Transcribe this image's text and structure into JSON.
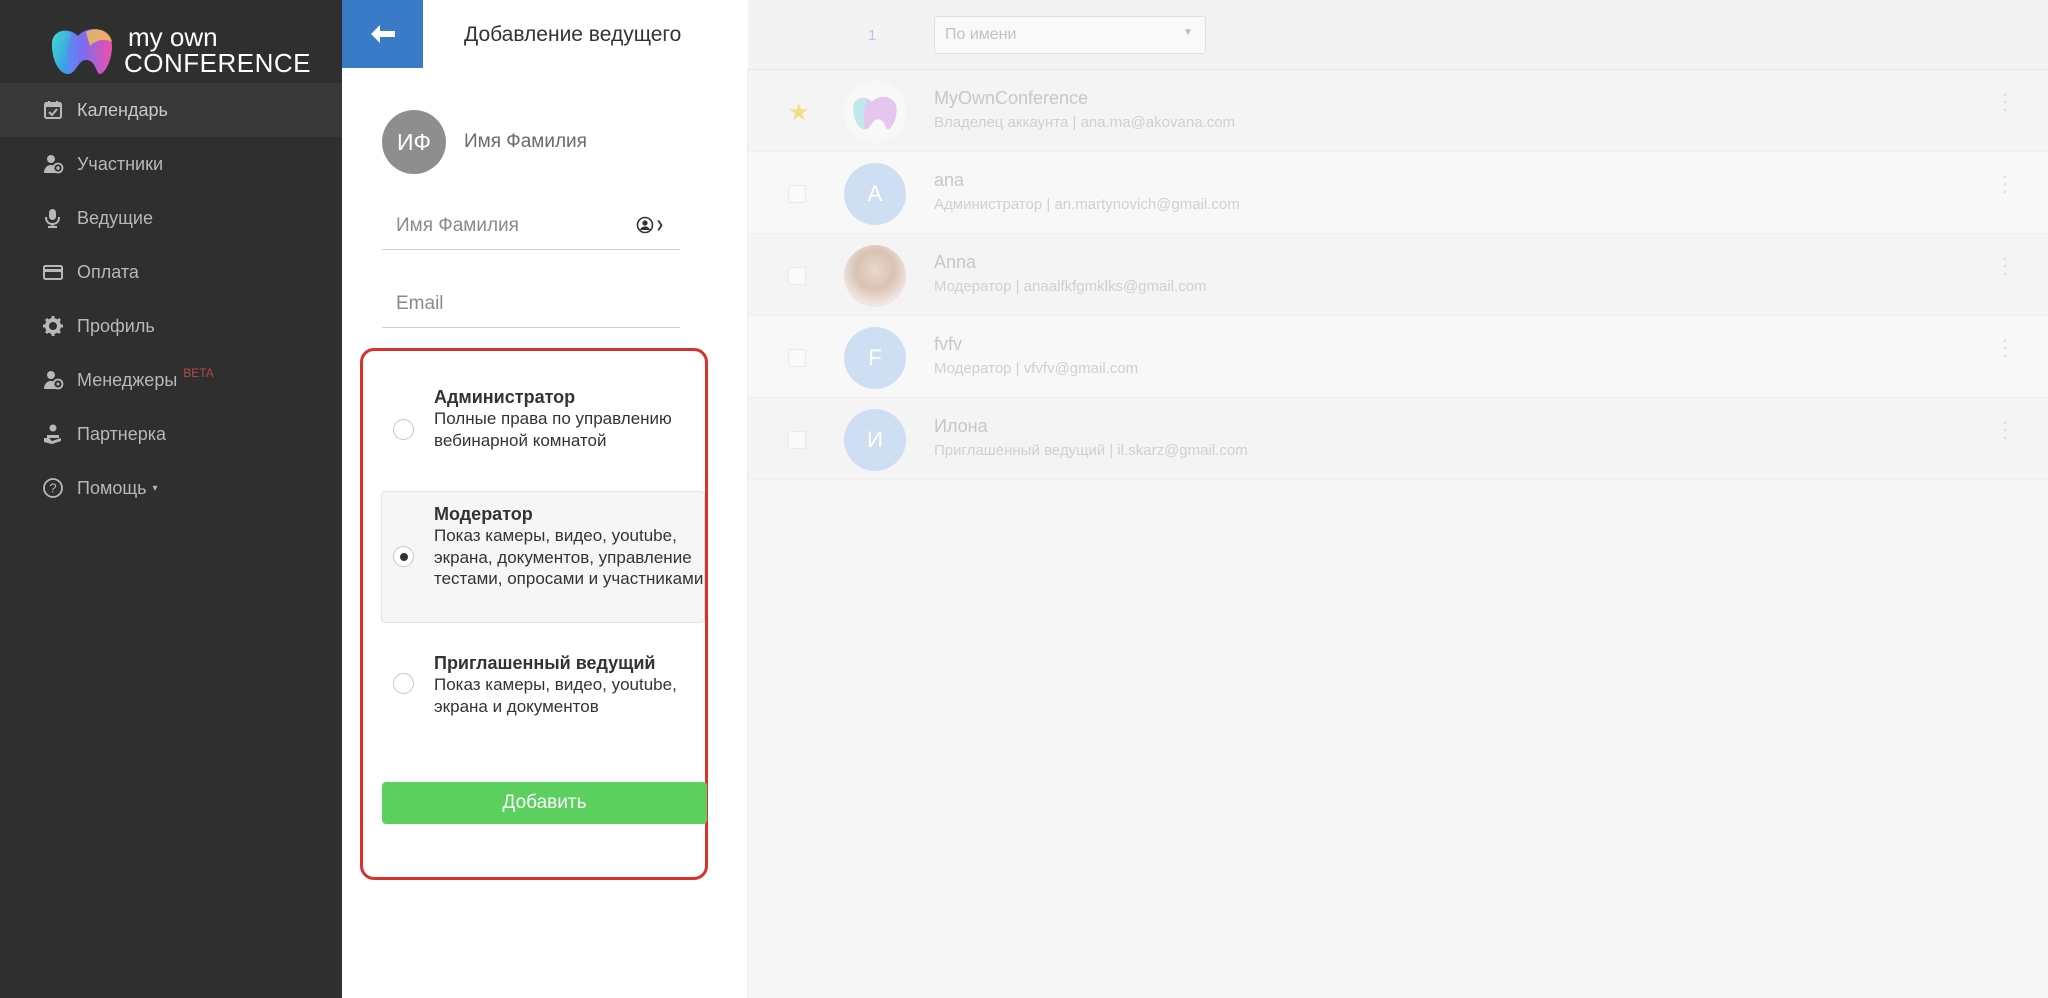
{
  "brand": {
    "line1": "my own",
    "line2": "CONFERENCE"
  },
  "sidebar": {
    "items": [
      {
        "label": "Календарь",
        "icon": "calendar-icon"
      },
      {
        "label": "Участники",
        "icon": "participants-icon"
      },
      {
        "label": "Ведущие",
        "icon": "presenter-icon"
      },
      {
        "label": "Оплата",
        "icon": "card-icon"
      },
      {
        "label": "Профиль",
        "icon": "gear-icon"
      },
      {
        "label": "Менеджеры",
        "icon": "managers-icon",
        "badge": "BETA"
      },
      {
        "label": "Партнерка",
        "icon": "partner-icon"
      },
      {
        "label": "Помощь",
        "icon": "help-icon",
        "caret": "▾"
      }
    ]
  },
  "panel": {
    "title": "Добавление ведущего",
    "preview_initials": "ИФ",
    "preview_name": "Имя Фамилия",
    "name_placeholder": "Имя Фамилия",
    "email_placeholder": "Email",
    "roles": [
      {
        "title": "Администратор",
        "desc": "Полные права по управлению вебинарной комнатой",
        "selected": false
      },
      {
        "title": "Модератор",
        "desc": "Показ камеры, видео, youtube, экрана, документов, управление тестами, опросами и участниками",
        "selected": true
      },
      {
        "title": "Приглашенный ведущий",
        "desc": "Показ камеры, видео, youtube, экрана и документов",
        "selected": false
      }
    ],
    "add_button": "Добавить"
  },
  "list": {
    "page": "1",
    "sort_value": "По имени",
    "rows": [
      {
        "name": "MyOwnConference",
        "sub": "Владелец аккаунта | ana.ma@akovana.com",
        "avatar": ""
      },
      {
        "name": "ana",
        "sub": "Администратор | an.martynovich@gmail.com",
        "avatar": "A"
      },
      {
        "name": "Anna",
        "sub": "Модератор | anaalfkfgmklks@gmail.com",
        "avatar": ""
      },
      {
        "name": "fvfv",
        "sub": "Модератор | vfvfv@gmail.com",
        "avatar": "F"
      },
      {
        "name": "Илона",
        "sub": "Приглашенный ведущий | il.skarz@gmail.com",
        "avatar": "И"
      }
    ]
  },
  "colors": {
    "sidebar_bg": "#2f2f2f",
    "back_button": "#3a7bc8",
    "add_button": "#5bd05e",
    "highlight_border": "#d9322a"
  }
}
